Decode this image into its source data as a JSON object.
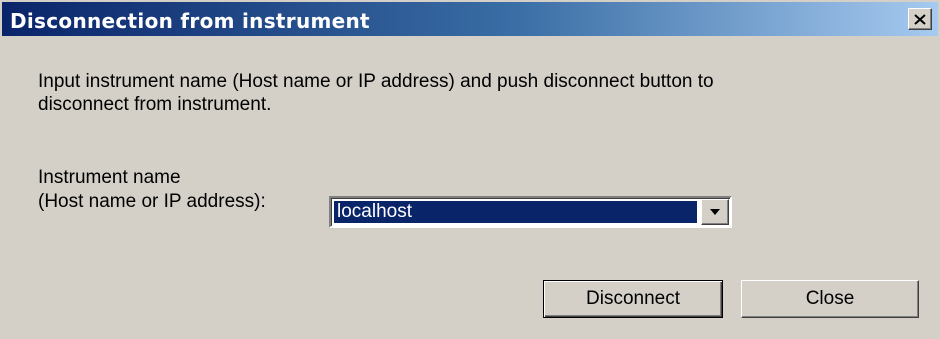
{
  "window": {
    "title": "Disconnection from instrument",
    "close_glyph": "close-x-icon"
  },
  "main": {
    "description": "Input instrument name (Host name or IP address) and push disconnect button to\ndisconnect from instrument.",
    "field_label_line1": "Instrument name",
    "field_label_line2": "(Host name or IP address):",
    "instrument_value": "localhost",
    "dropdown_icon": "chevron-down-icon"
  },
  "buttons": {
    "disconnect_label": "Disconnect",
    "close_label": "Close"
  },
  "colors": {
    "titlebar_start": "#0a246a",
    "titlebar_end": "#a6caf0",
    "face": "#d4d0c8",
    "selection": "#0a246a"
  }
}
